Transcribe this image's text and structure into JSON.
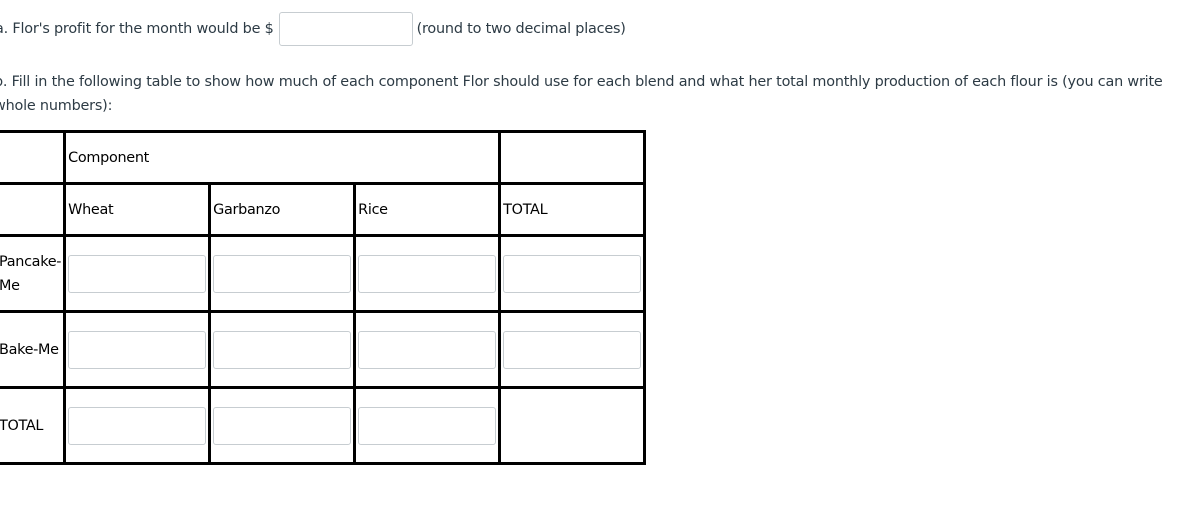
{
  "question_a": {
    "prefix": "a. Flor's profit for the month would be $",
    "input_value": "",
    "suffix": "(round to two decimal places)"
  },
  "question_b": {
    "text": "b. Fill in the following table to show how much of each component Flor should use for each blend and what her total monthly production of each flour is (you can write whole numbers):"
  },
  "table": {
    "group_header": "Component",
    "columns": [
      "Wheat",
      "Garbanzo",
      "Rice",
      "TOTAL"
    ],
    "rows": [
      {
        "label": "Pancake-Me",
        "values": [
          "",
          "",
          "",
          ""
        ]
      },
      {
        "label": "Bake-Me",
        "values": [
          "",
          "",
          "",
          ""
        ]
      },
      {
        "label": "TOTAL",
        "values": [
          "",
          "",
          ""
        ]
      }
    ]
  }
}
